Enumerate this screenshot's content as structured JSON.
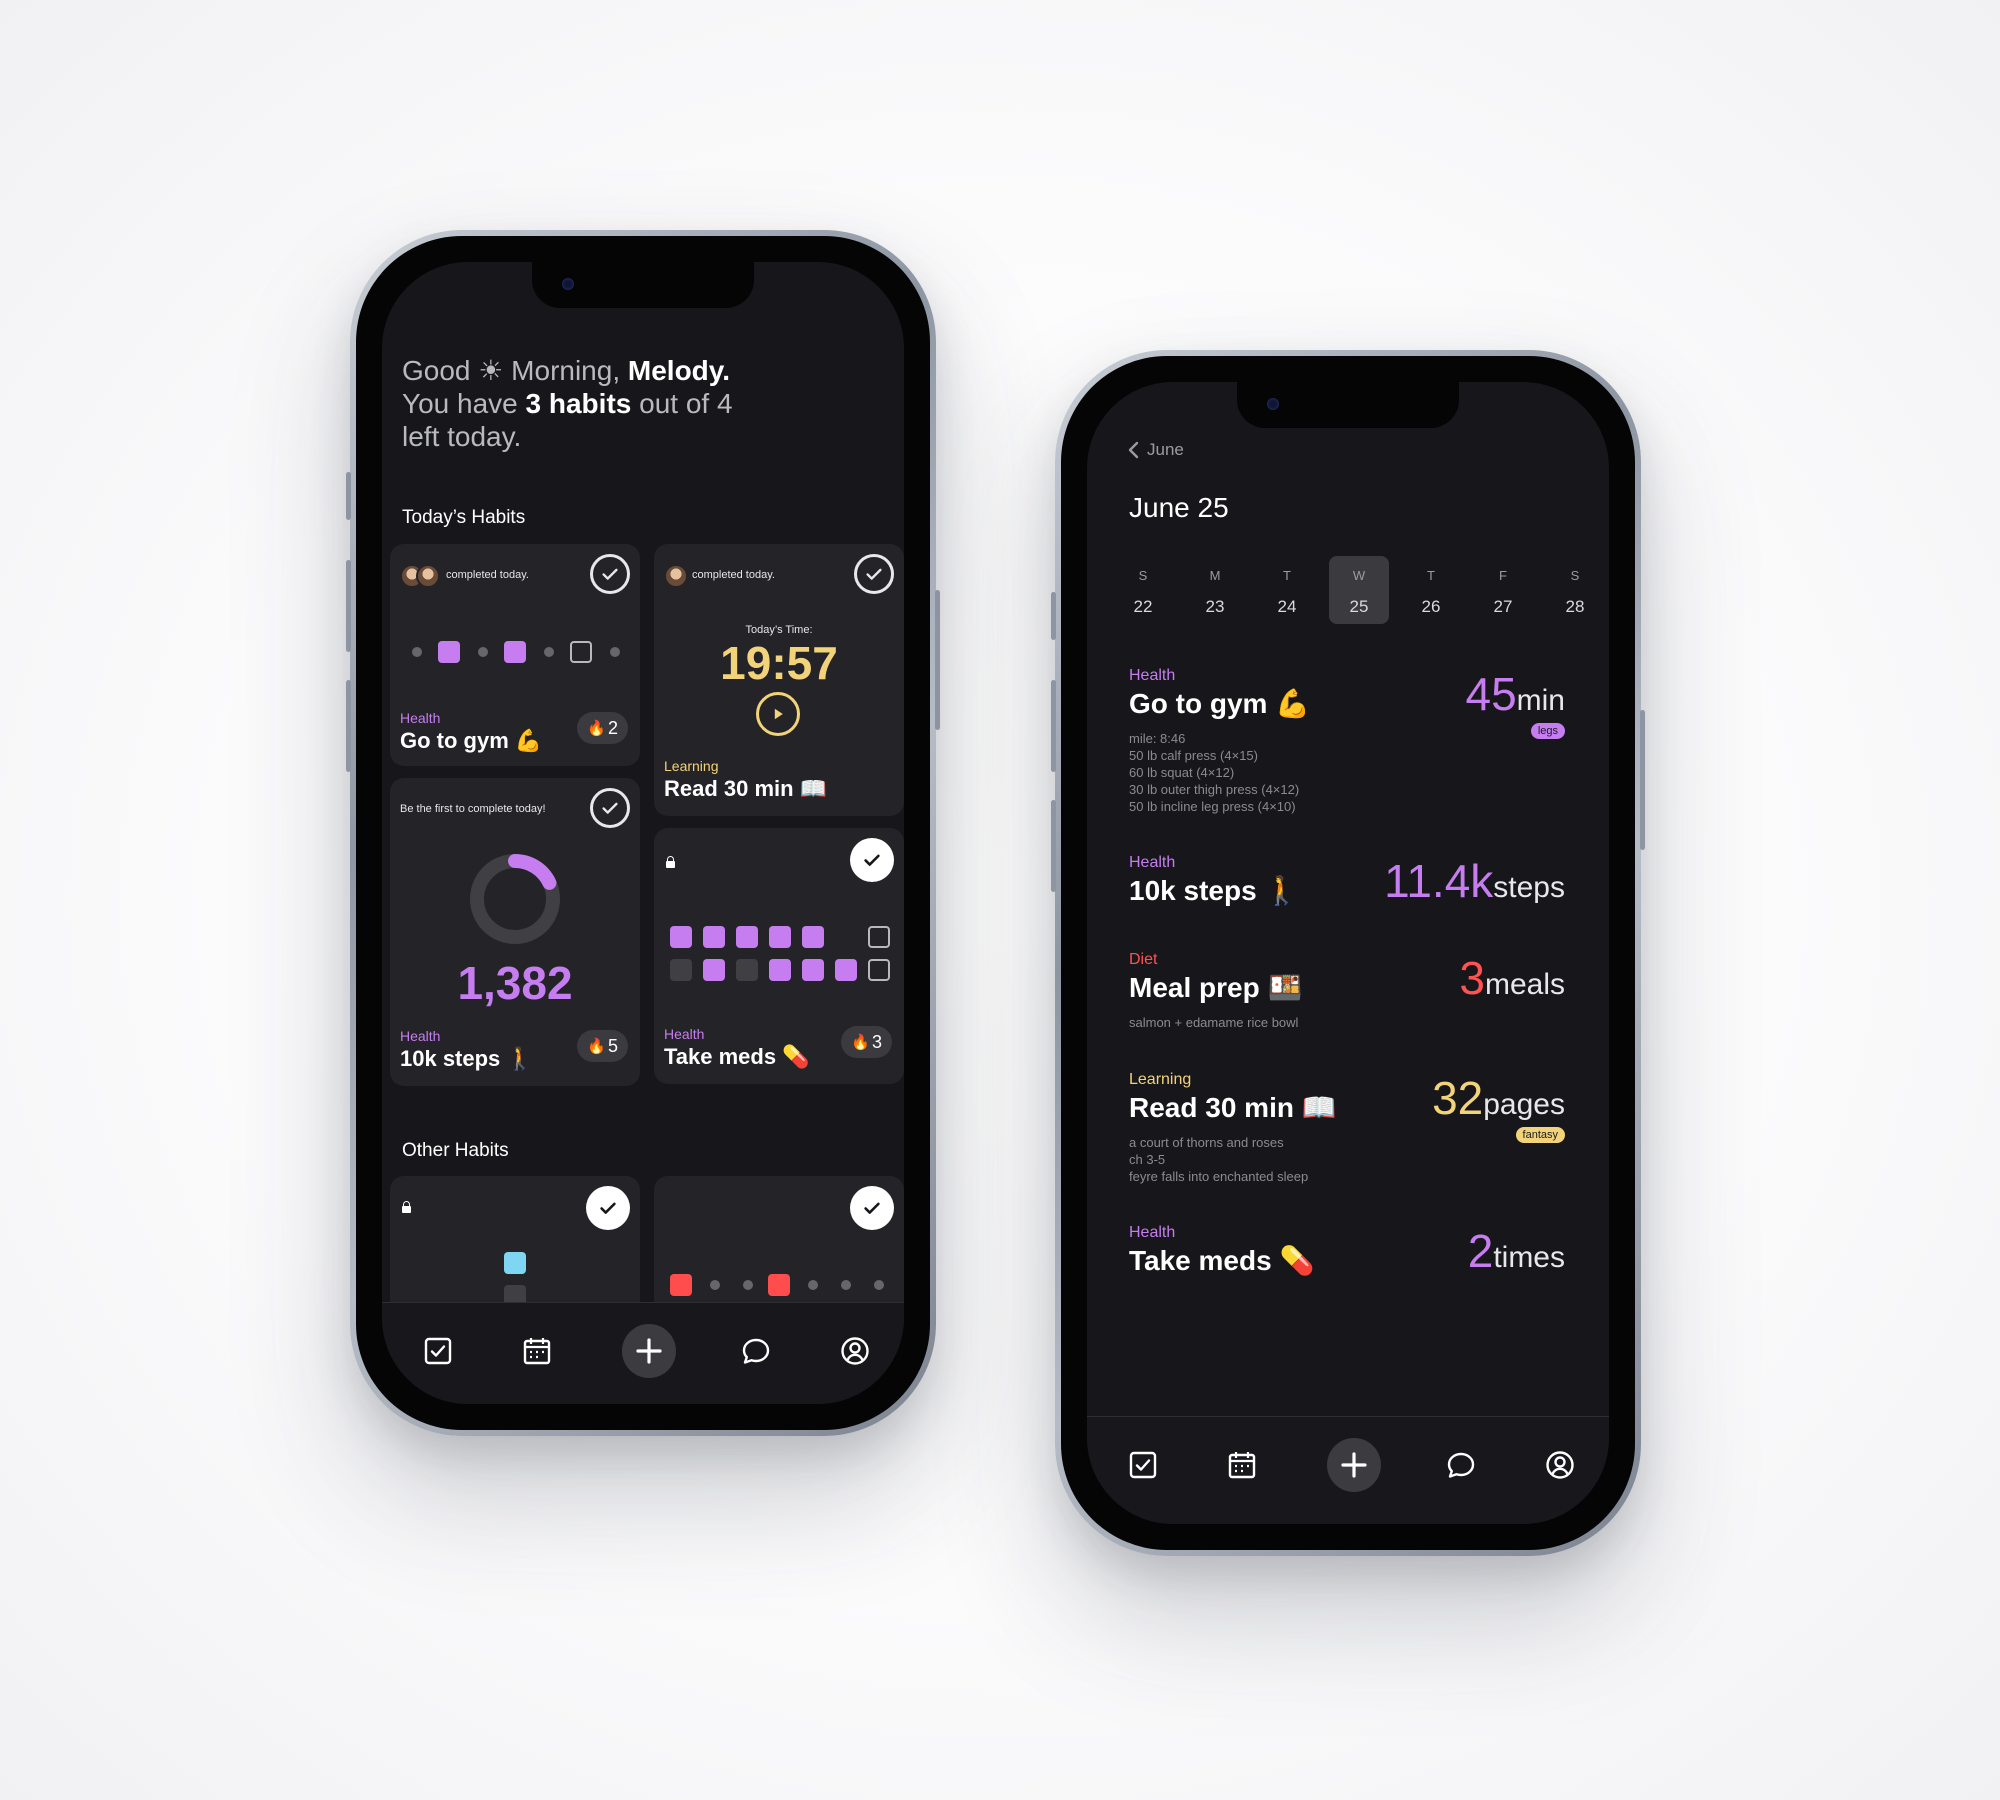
{
  "colors": {
    "accent_purple": "#c57df0",
    "accent_yellow": "#f2d37a",
    "accent_red": "#ff5252",
    "accent_blue": "#7fd6f2",
    "screen_bg": "#17171b",
    "card_bg": "#242428"
  },
  "left_phone": {
    "greeting": {
      "good": "Good",
      "sun_icon": "☀",
      "morning": "Morning,",
      "name": "Melody.",
      "line2_prefix": "You have",
      "count": "3 habits",
      "line2_suffix": "out of 4",
      "line3": "left today."
    },
    "todays_habits_title": "Today’s Habits",
    "other_habits_title": "Other Habits",
    "cards": {
      "gym": {
        "note": "completed today.",
        "category": "Health",
        "name": "Go to gym 💪",
        "streak": "2",
        "fire": "🔥"
      },
      "read": {
        "note": "completed today.",
        "timer_label": "Today’s Time:",
        "timer": "19:57",
        "category": "Learning",
        "name": "Read 30 min 📖"
      },
      "steps": {
        "note": "Be the first to complete today!",
        "value": "1,382",
        "progress": 0.18,
        "category": "Health",
        "name": "10k steps 🚶",
        "streak": "5",
        "fire": "🔥"
      },
      "meds": {
        "category": "Health",
        "name": "Take meds 💊",
        "streak": "3",
        "fire": "🔥"
      }
    }
  },
  "right_phone": {
    "back_label": "June",
    "date_title": "June 25",
    "week": [
      {
        "l": "S",
        "n": "22"
      },
      {
        "l": "M",
        "n": "23"
      },
      {
        "l": "T",
        "n": "24"
      },
      {
        "l": "W",
        "n": "25"
      },
      {
        "l": "T",
        "n": "26"
      },
      {
        "l": "F",
        "n": "27"
      },
      {
        "l": "S",
        "n": "28"
      }
    ],
    "selected_day_index": 3,
    "entries": [
      {
        "category": "Health",
        "title": "Go to gym 💪",
        "details": [
          "mile: 8:46",
          "50 lb calf press (4×15)",
          "60 lb squat (4×12)",
          "30 lb outer thigh press (4×12)",
          "50 lb incline leg press (4×10)"
        ],
        "value": "45",
        "unit": "min",
        "tag": "legs"
      },
      {
        "category": "Health",
        "title": "10k steps 🚶",
        "details": [],
        "value": "11.4k",
        "unit": "steps",
        "tag": ""
      },
      {
        "category": "Diet",
        "title": "Meal prep 🍱",
        "details": [
          "salmon + edamame rice bowl"
        ],
        "value": "3",
        "unit": "meals",
        "tag": ""
      },
      {
        "category": "Learning",
        "title": "Read 30 min 📖",
        "details": [
          "a court of thorns and roses",
          "ch 3-5",
          "feyre falls into enchanted sleep"
        ],
        "value": "32",
        "unit": "pages",
        "tag": "fantasy"
      },
      {
        "category": "Health",
        "title": "Take meds 💊",
        "details": [],
        "value": "2",
        "unit": "times",
        "tag": ""
      }
    ]
  },
  "tabbar": {
    "items": [
      "habits-tab",
      "calendar-tab",
      "add-button",
      "chat-tab",
      "profile-tab"
    ]
  }
}
